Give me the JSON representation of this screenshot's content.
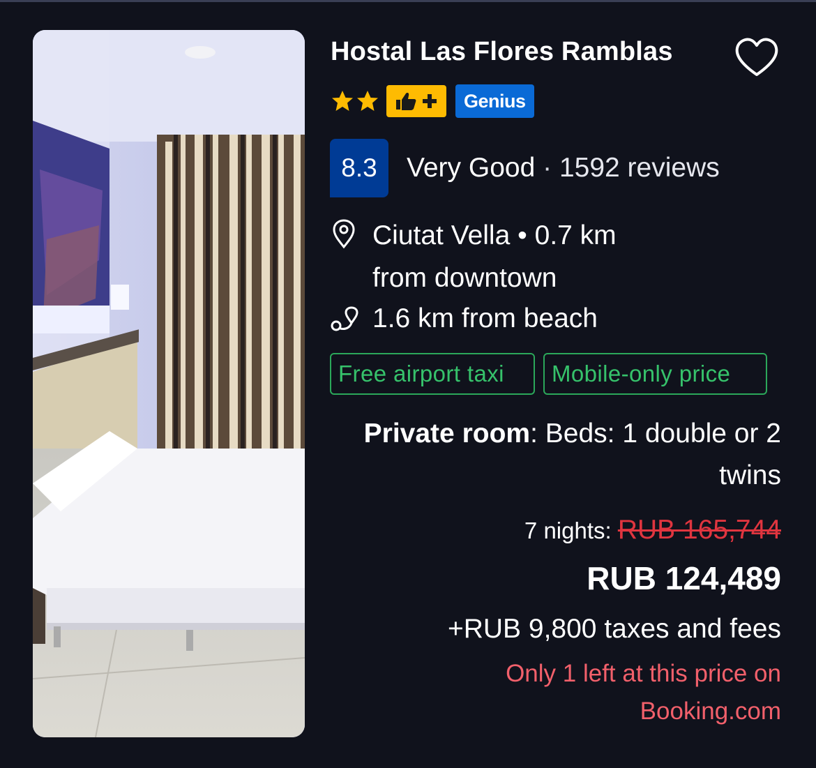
{
  "hotel": {
    "name": "Hostal Las Flores Ramblas",
    "stars": 2,
    "badges": {
      "genius_label": "Genius"
    },
    "rating": {
      "score": "8.3",
      "label": "Very Good",
      "reviews": "1592 reviews"
    },
    "location": {
      "district": "Ciutat Vella",
      "distance": "0.7 km",
      "distance_suffix": "from downtown"
    },
    "beach_distance": "1.6 km from beach",
    "tags": [
      "Free airport taxi",
      "Mobile-only price"
    ],
    "room": {
      "type": "Private room",
      "beds": "Beds: 1 double or 2 twins"
    },
    "pricing": {
      "nights_label": "7 nights:",
      "original_price": "RUB 165,744",
      "price": "RUB 124,489",
      "taxes": "+RUB 9,800 taxes and fees"
    },
    "scarcity": "Only 1 left at this price on Booking.com"
  },
  "icons": {
    "favorite": "heart-outline-icon",
    "star": "star-icon",
    "preferred": "thumbs-up-plus-icon",
    "location": "map-pin-icon",
    "beach": "route-pin-icon"
  },
  "colors": {
    "background": "#10121c",
    "score_bg": "#003b95",
    "star": "#febb02",
    "genius": "#0a6ad6",
    "tag_green": "#36c26b",
    "strike_red": "#e0353f",
    "scarcity_red": "#f2606b"
  }
}
